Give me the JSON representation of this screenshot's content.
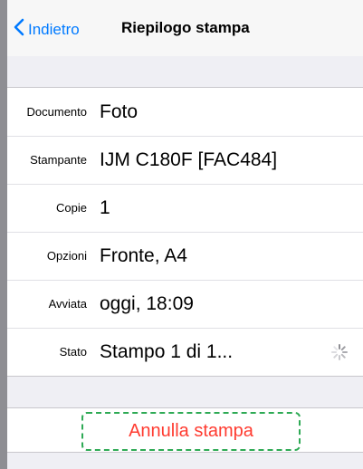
{
  "navbar": {
    "back_label": "Indietro",
    "title": "Riepilogo stampa"
  },
  "details": {
    "rows": [
      {
        "label": "Documento",
        "value": "Foto"
      },
      {
        "label": "Stampante",
        "value": "IJM C180F [FAC484]"
      },
      {
        "label": "Copie",
        "value": "1"
      },
      {
        "label": "Opzioni",
        "value": "Fronte, A4"
      },
      {
        "label": "Avviata",
        "value": "oggi, 18:09"
      },
      {
        "label": "Stato",
        "value": "Stampo 1 di 1..."
      }
    ]
  },
  "actions": {
    "cancel_label": "Annulla stampa"
  },
  "colors": {
    "accent": "#007aff",
    "destructive": "#ff3b30",
    "focus_outline": "#2eaa55"
  }
}
